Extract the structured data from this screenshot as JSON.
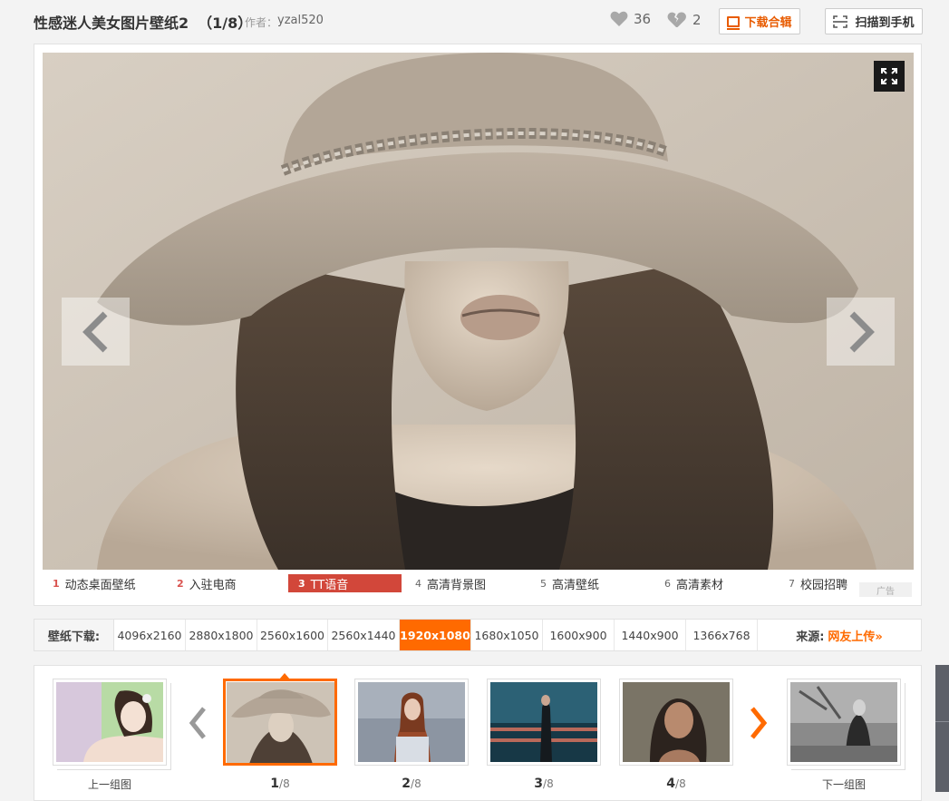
{
  "header": {
    "title": "性感迷人美女图片壁纸2",
    "count": "（1/8）",
    "author_label": "作者：",
    "author_name": "yzal520",
    "likes": "36",
    "dislikes": "2",
    "download_label": "下载合辑",
    "scan_label": "扫描到手机"
  },
  "ad_links": [
    {
      "num": "1",
      "label": "动态桌面壁纸"
    },
    {
      "num": "2",
      "label": "入驻电商"
    },
    {
      "num": "3",
      "label": "TT语音"
    },
    {
      "num": "4",
      "label": "高清背景图"
    },
    {
      "num": "5",
      "label": "高清壁纸"
    },
    {
      "num": "6",
      "label": "高清素材"
    },
    {
      "num": "7",
      "label": "校园招聘"
    }
  ],
  "ad_badge": "广告",
  "resolution": {
    "label": "壁纸下载:",
    "options": [
      "4096x2160",
      "2880x1800",
      "2560x1600",
      "2560x1440",
      "1920x1080",
      "1680x1050",
      "1600x900",
      "1440x900",
      "1366x768"
    ],
    "selected": "1920x1080",
    "source_label": "来源:",
    "source_link": "网友上传»"
  },
  "thumbnails": {
    "prev_group": "上一组图",
    "next_group": "下一组图",
    "items": [
      {
        "index": "1",
        "total": "/8"
      },
      {
        "index": "2",
        "total": "/8"
      },
      {
        "index": "3",
        "total": "/8"
      },
      {
        "index": "4",
        "total": "/8"
      }
    ]
  },
  "colors": {
    "accent": "#ff6a00",
    "ad_active": "#d2473a"
  }
}
